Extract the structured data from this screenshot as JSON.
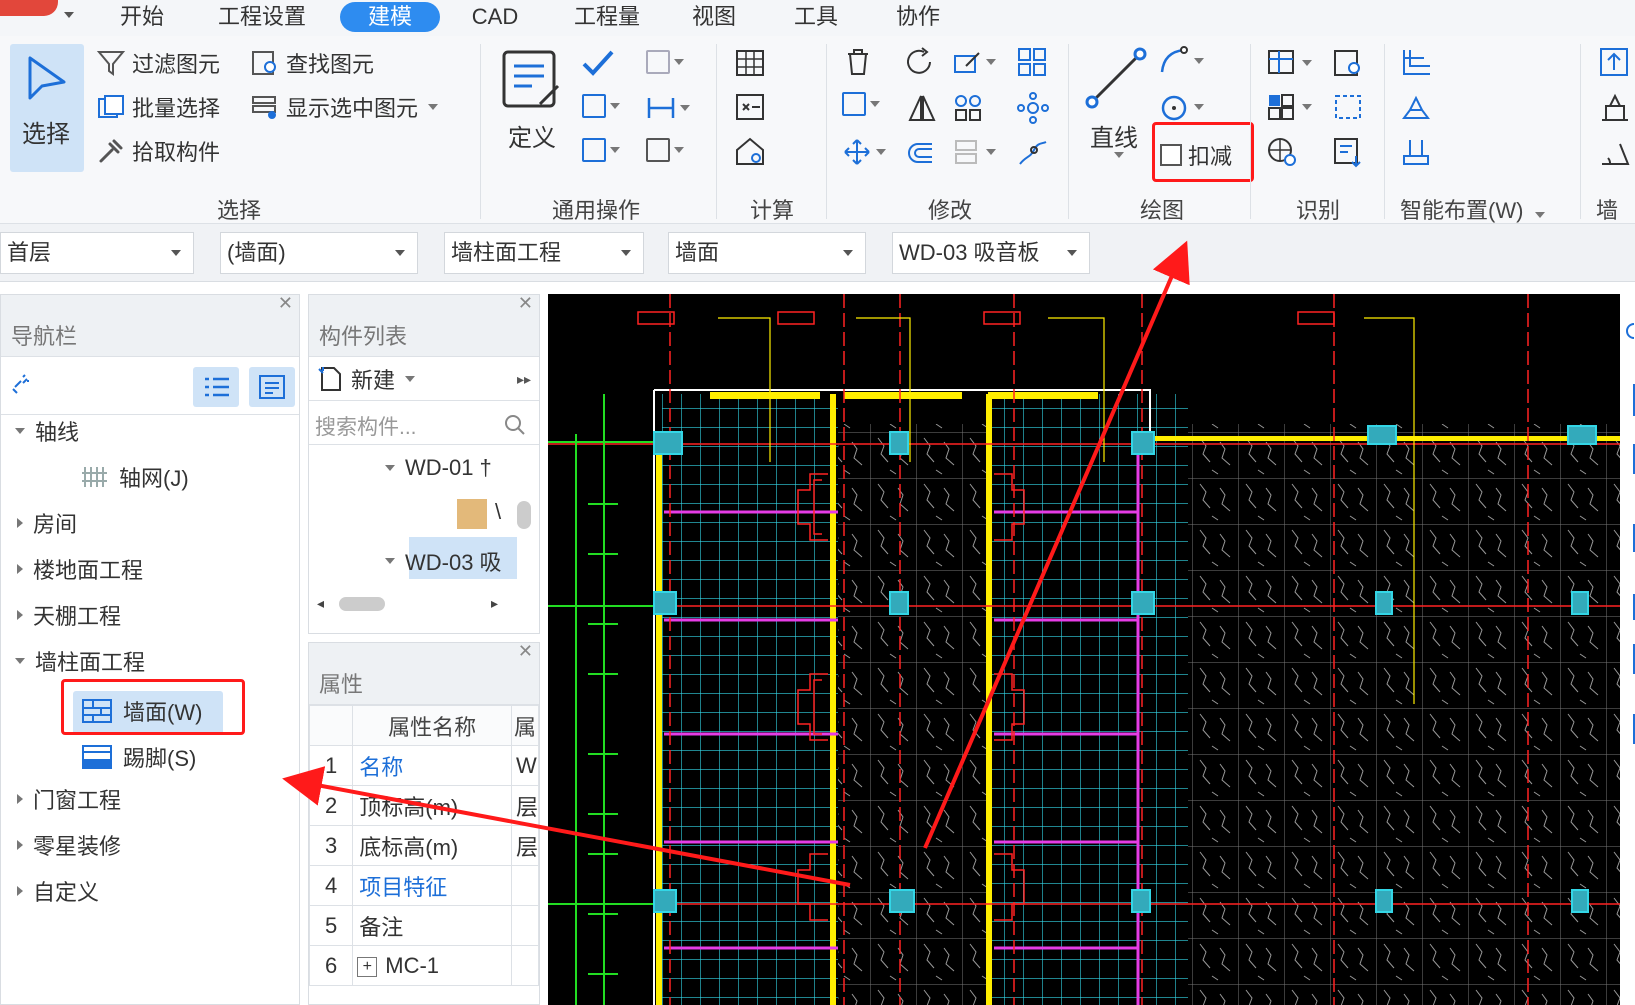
{
  "menu": {
    "items": [
      "开始",
      "工程设置",
      "建模",
      "CAD",
      "工程量",
      "视图",
      "工具",
      "协作"
    ],
    "active_index": 2
  },
  "ribbon": {
    "select_group": {
      "big_button": "选择",
      "filter": "过滤图元",
      "find": "查找图元",
      "batch_select": "批量选择",
      "show_selected": "显示选中图元",
      "pick": "拾取构件",
      "label": "选择"
    },
    "general_group": {
      "define": "定义",
      "label": "通用操作"
    },
    "calc_group": {
      "label": "计算"
    },
    "modify_group": {
      "label": "修改"
    },
    "draw_group": {
      "line": "直线",
      "deduct": "扣减",
      "label": "绘图"
    },
    "identify_group": {
      "label": "识别"
    },
    "smart_group": {
      "label": "智能布置(W)"
    },
    "wall_group": {
      "label": "墙面"
    }
  },
  "floor_bar": {
    "floor": "首层",
    "category": "(墙面)",
    "discipline": "墙柱面工程",
    "type": "墙面",
    "component": "WD-03 吸音板"
  },
  "nav_panel": {
    "title": "导航栏",
    "tree": [
      {
        "label": "轴线",
        "expanded": true,
        "children": [
          "轴网(J)"
        ]
      },
      {
        "label": "房间"
      },
      {
        "label": "楼地面工程"
      },
      {
        "label": "天棚工程"
      },
      {
        "label": "墙柱面工程",
        "expanded": true,
        "children": [
          "墙面(W)",
          "踢脚(S)"
        ]
      },
      {
        "label": "门窗工程"
      },
      {
        "label": "零星装修"
      },
      {
        "label": "自定义"
      }
    ]
  },
  "component_panel": {
    "title": "构件列表",
    "new_label": "新建",
    "search_placeholder": "搜索构件...",
    "items": [
      "WD-01 †",
      "\\",
      "WD-03 吸"
    ]
  },
  "property_panel": {
    "title": "属性",
    "header": "属性名称",
    "header_col3": "属",
    "rows": [
      {
        "num": "1",
        "name": "名称",
        "value": "W",
        "link": true
      },
      {
        "num": "2",
        "name": "顶标高(m)",
        "value": "层"
      },
      {
        "num": "3",
        "name": "底标高(m)",
        "value": "层"
      },
      {
        "num": "4",
        "name": "项目特征",
        "value": "",
        "link": true
      },
      {
        "num": "5",
        "name": "备注",
        "value": ""
      },
      {
        "num": "6",
        "name": "MC-1",
        "value": "",
        "expand": true
      }
    ]
  },
  "colors": {
    "accent": "#2e8cf0",
    "annotation_red": "#ff1a1a",
    "canvas_bg": "#000000",
    "cad_cyan": "#33d6e6",
    "cad_yellow": "#ffee00",
    "cad_magenta": "#e63ce6"
  }
}
